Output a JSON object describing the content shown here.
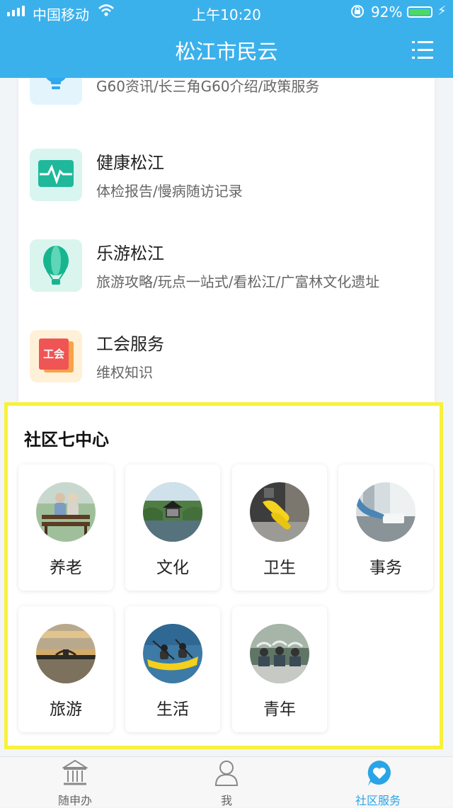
{
  "status_bar": {
    "carrier": "中国移动",
    "time": "上午10:20",
    "battery": "92%"
  },
  "header": {
    "title": "松江市民云"
  },
  "services": [
    {
      "name": "",
      "desc": "G60资讯/长三角G60介绍/政策服务",
      "icon": "lightbulb-icon"
    },
    {
      "name": "健康松江",
      "desc": "体检报告/慢病随访记录",
      "icon": "heart-monitor-icon"
    },
    {
      "name": "乐游松江",
      "desc": "旅游攻略/玩点一站式/看松江/广富林文化遗址",
      "icon": "hot-air-balloon-icon"
    },
    {
      "name": "工会服务",
      "desc": "维权知识",
      "icon": "union-badge-icon",
      "badge": "工会"
    }
  ],
  "community": {
    "title": "社区七中心",
    "items": [
      {
        "label": "养老",
        "image": "elderly-couple-bench"
      },
      {
        "label": "文化",
        "image": "pavilion-lake"
      },
      {
        "label": "卫生",
        "image": "cleaning-gloves"
      },
      {
        "label": "事务",
        "image": "office-desk"
      },
      {
        "label": "旅游",
        "image": "sunset-bridge"
      },
      {
        "label": "生活",
        "image": "kayaking"
      },
      {
        "label": "青年",
        "image": "youth-group"
      }
    ]
  },
  "tabbar": [
    {
      "label": "随申办",
      "icon": "government-building-icon",
      "active": false
    },
    {
      "label": "我",
      "icon": "person-icon",
      "active": false
    },
    {
      "label": "社区服务",
      "icon": "heart-bubble-icon",
      "active": true
    }
  ],
  "colors": {
    "primary": "#3bb1ec",
    "highlight_border": "#f7f23a",
    "active_tab": "#2aa4e6"
  }
}
